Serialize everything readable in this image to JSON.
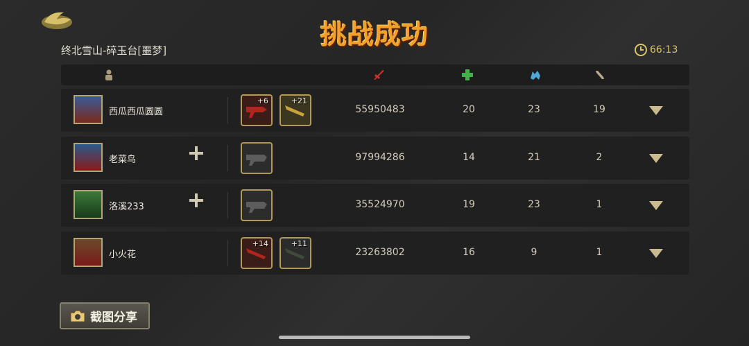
{
  "header": {
    "title": "挑战成功",
    "stage": "终北雪山-碎玉台[噩梦]",
    "timer": "66:13",
    "colors": {
      "title": "#f1a02b",
      "timer": "#d9c66a",
      "damage_icon": "#c8332b",
      "heal_icon": "#43b04a",
      "tank_icon": "#4fa8d9"
    }
  },
  "columns": {
    "icons": [
      "player-icon",
      "damage-icon",
      "heal-icon",
      "tank-icon",
      "bone-icon"
    ]
  },
  "rows": [
    {
      "name": "西瓜西瓜圆圆",
      "has_add": false,
      "weapons": [
        {
          "badge": "+6",
          "kind": "red"
        },
        {
          "badge": "+21",
          "kind": "gold"
        }
      ],
      "damage": "55950483",
      "heal": "20",
      "tank": "23",
      "misc": "19"
    },
    {
      "name": "老菜鸟",
      "has_add": true,
      "weapons": [
        {
          "badge": "",
          "kind": "gray"
        }
      ],
      "damage": "97994286",
      "heal": "14",
      "tank": "21",
      "misc": "2"
    },
    {
      "name": "洛溪233",
      "has_add": true,
      "weapons": [
        {
          "badge": "",
          "kind": "gray"
        }
      ],
      "damage": "35524970",
      "heal": "19",
      "tank": "23",
      "misc": "1"
    },
    {
      "name": "小火花",
      "has_add": false,
      "weapons": [
        {
          "badge": "+14",
          "kind": "red"
        },
        {
          "badge": "+11",
          "kind": "dark"
        }
      ],
      "damage": "23263802",
      "heal": "16",
      "tank": "9",
      "misc": "1"
    }
  ],
  "footer": {
    "share_label": "截图分享"
  }
}
